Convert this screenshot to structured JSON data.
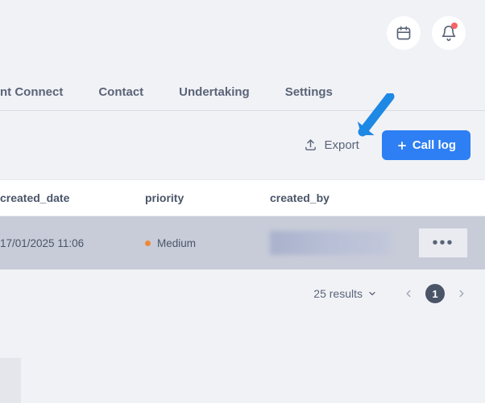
{
  "topbar": {
    "calendar_icon": "calendar",
    "bell_icon": "bell"
  },
  "tabs": {
    "items": [
      {
        "label": "nt Connect"
      },
      {
        "label": "Contact"
      },
      {
        "label": "Undertaking"
      },
      {
        "label": "Settings"
      }
    ]
  },
  "actions": {
    "export_label": "Export",
    "calllog_label": "Call log"
  },
  "table": {
    "headers": {
      "created_date": "created_date",
      "priority": "priority",
      "created_by": "created_by"
    },
    "rows": [
      {
        "created_date": "17/01/2025 11:06",
        "priority": "Medium",
        "created_by": ""
      }
    ]
  },
  "pagination": {
    "results_label": "25 results",
    "current_page": "1"
  }
}
